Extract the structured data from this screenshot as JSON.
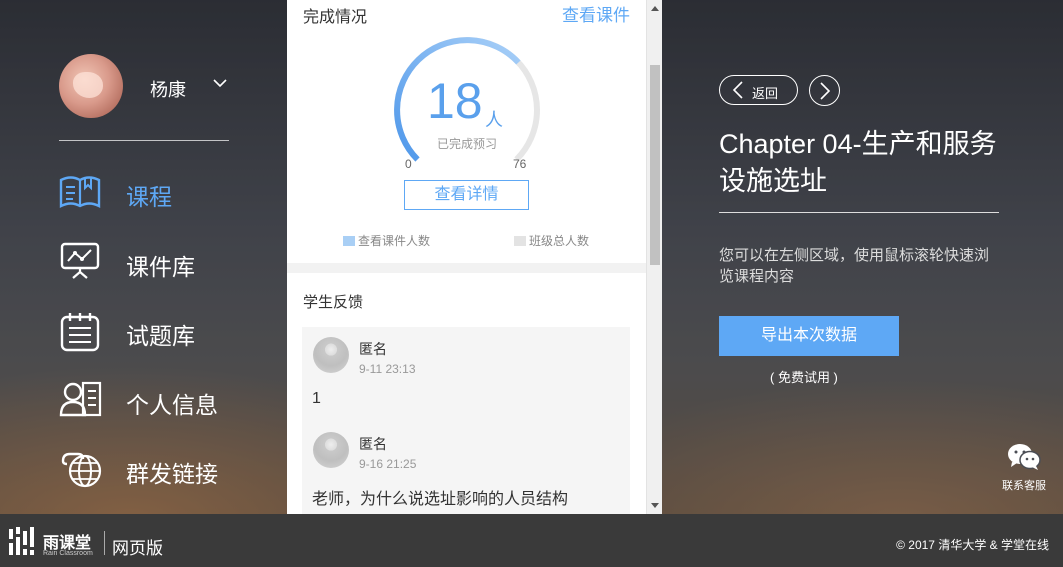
{
  "user": {
    "name": "杨康"
  },
  "nav": [
    {
      "label": "课程",
      "icon": "book-icon",
      "active": true
    },
    {
      "label": "课件库",
      "icon": "presentation-icon",
      "active": false
    },
    {
      "label": "试题库",
      "icon": "notepad-icon",
      "active": false
    },
    {
      "label": "个人信息",
      "icon": "person-card-icon",
      "active": false
    },
    {
      "label": "群发链接",
      "icon": "globe-link-icon",
      "active": false
    }
  ],
  "completion": {
    "title": "完成情况",
    "view_link": "查看课件",
    "count": "18",
    "unit": "人",
    "label": "已完成预习",
    "min": "0",
    "max": "76",
    "completed": 18,
    "total": 76,
    "detail_button": "查看详情",
    "legend_viewed": "查看课件人数",
    "legend_total": "班级总人数"
  },
  "feedback": {
    "title": "学生反馈",
    "items": [
      {
        "name": "匿名",
        "time": "9-11 23:13",
        "text": "1"
      },
      {
        "name": "匿名",
        "time": "9-16 21:25",
        "text": "老师，为什么说选址影响的人员结构"
      }
    ]
  },
  "right": {
    "back_label": "返回",
    "chapter_title": "Chapter 04-生产和服务设施选址",
    "hint": "您可以在左侧区域，使用鼠标滚轮快速浏览课程内容",
    "export_button": "导出本次数据",
    "trial_note": "( 免费试用 )",
    "service_label": "联系客服"
  },
  "footer": {
    "logo_name": "雨课堂",
    "logo_sub": "Rain Classroom",
    "web_label": "网页版",
    "copyright": "© 2017 清华大学 & 学堂在线"
  },
  "colors": {
    "accent": "#5ea8f5",
    "gauge_track": "#e6e6e6",
    "footer_bg": "#3a3a3a"
  }
}
